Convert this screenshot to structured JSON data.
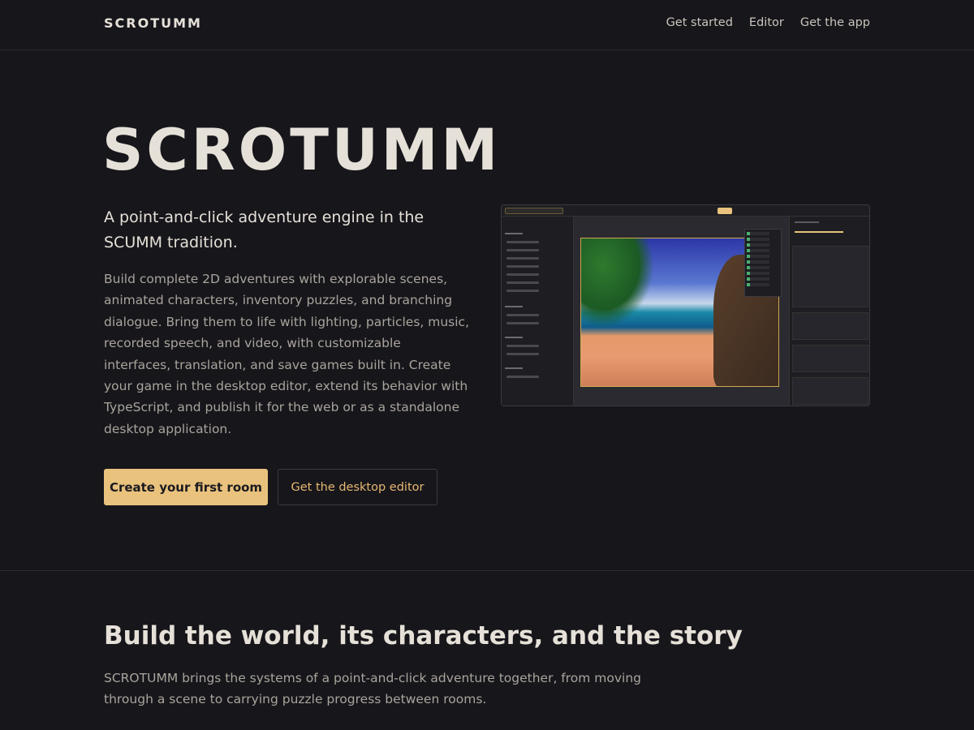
{
  "nav": {
    "brand": "SCROTUMM",
    "links": [
      "Get started",
      "Editor",
      "Get the app"
    ]
  },
  "hero": {
    "title": "SCROTUMM",
    "subtitle": "A point-and-click adventure engine in the SCUMM tradition.",
    "body": "Build complete 2D adventures with explorable scenes, animated characters, inventory puzzles, and branching dialogue. Bring them to life with lighting, particles, music, recorded speech, and video, with customizable interfaces, translation, and save games built in. Create your game in the desktop editor, extend its behavior with TypeScript, and publish it for the web or as a standalone desktop application.",
    "primary_button": "Create your first room",
    "secondary_button": "Get the desktop editor"
  },
  "section": {
    "title": "Build the world, its characters, and the story",
    "body": "SCROTUMM brings the systems of a point-and-click adventure together, from moving through a scene to carrying puzzle progress between rooms."
  },
  "colors": {
    "background": "#17161b",
    "accent": "#e9c27d",
    "text": "#e6e1d8",
    "muted": "#a9a49c"
  }
}
